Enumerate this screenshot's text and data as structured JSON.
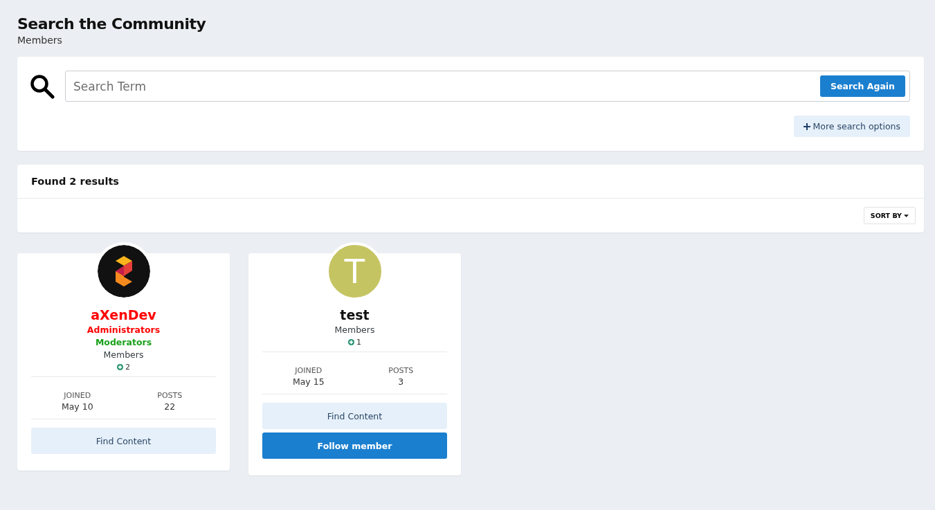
{
  "header": {
    "title": "Search the Community",
    "subtitle": "Members"
  },
  "search": {
    "placeholder": "Search Term",
    "button": "Search Again",
    "more_options": "More search options"
  },
  "results": {
    "title": "Found 2 results",
    "sort": "SORT BY"
  },
  "members": [
    {
      "avatar": {
        "kind": "image"
      },
      "name": "aXenDev",
      "color": "#ff0000",
      "groups": [
        {
          "label": "Administrators",
          "color": "#ff0000"
        },
        {
          "label": "Moderators",
          "color": "#1aa11a"
        },
        {
          "label": "Members",
          "color": "#353c41"
        }
      ],
      "reputation": "2",
      "stats": [
        {
          "label": "JOINED",
          "value": "May 10"
        },
        {
          "label": "POSTS",
          "value": "22"
        }
      ],
      "buttons": [
        {
          "label": "Find Content",
          "kind": "light"
        }
      ]
    },
    {
      "avatar": {
        "kind": "letter",
        "letter": "T",
        "color": "#c5c462"
      },
      "name": "test",
      "color": "#111111",
      "groups": [
        {
          "label": "Members",
          "color": "#353c41"
        }
      ],
      "reputation": "1",
      "stats": [
        {
          "label": "JOINED",
          "value": "May 15"
        },
        {
          "label": "POSTS",
          "value": "3"
        }
      ],
      "buttons": [
        {
          "label": "Find Content",
          "kind": "light"
        },
        {
          "label": "Follow member",
          "kind": "primary"
        }
      ]
    }
  ]
}
